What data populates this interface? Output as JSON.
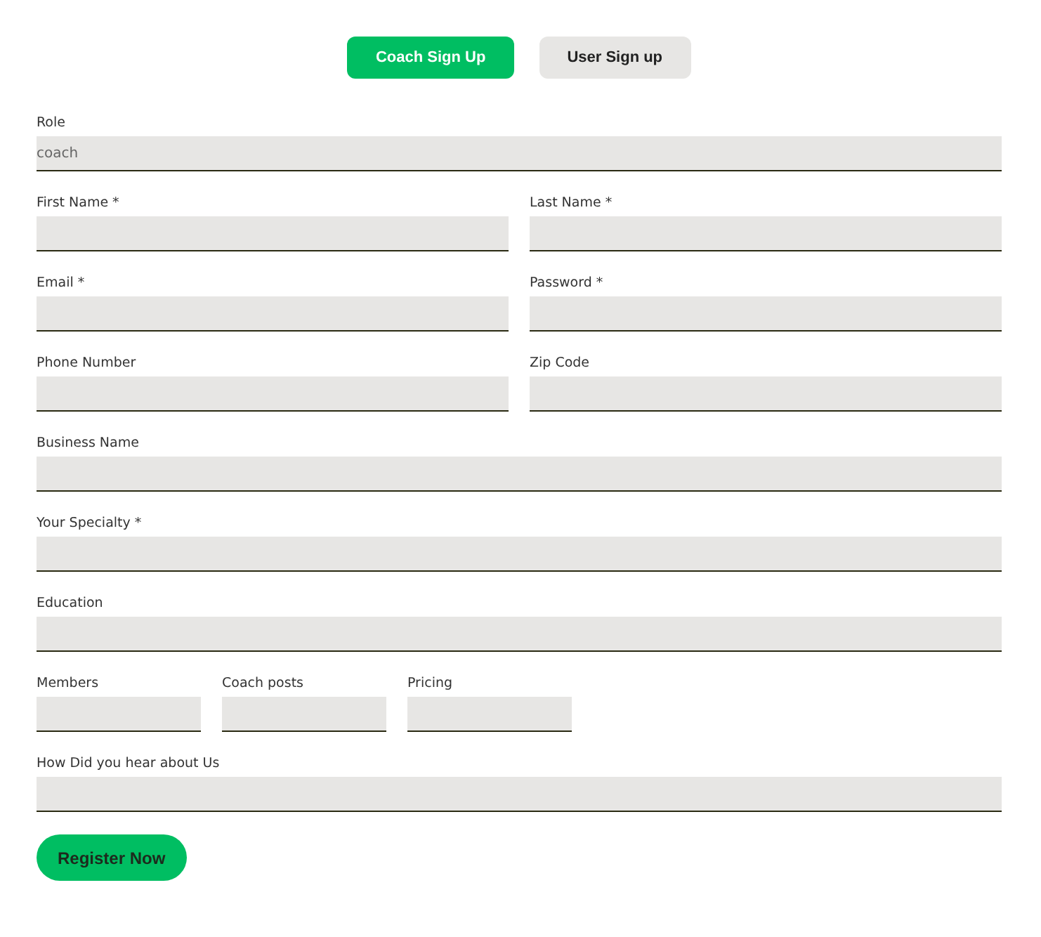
{
  "tabs": [
    {
      "label": "Coach Sign Up",
      "selected": true
    },
    {
      "label": "User Sign up",
      "selected": false
    }
  ],
  "rows": [
    {
      "kind": "full",
      "fields": [
        {
          "label": "Role",
          "value": "coach"
        }
      ]
    },
    {
      "kind": "half",
      "fields": [
        {
          "label": "First Name *"
        },
        {
          "label": "Last Name *"
        }
      ]
    },
    {
      "kind": "half",
      "fields": [
        {
          "label": "Email *"
        },
        {
          "label": "Password *"
        }
      ]
    },
    {
      "kind": "half",
      "fields": [
        {
          "label": "Phone Number"
        },
        {
          "label": "Zip Code"
        }
      ]
    },
    {
      "kind": "full",
      "fields": [
        {
          "label": "Business Name"
        }
      ]
    },
    {
      "kind": "full",
      "fields": [
        {
          "label": "Your Specialty *"
        }
      ]
    },
    {
      "kind": "full",
      "fields": [
        {
          "label": "Education"
        }
      ]
    },
    {
      "kind": "small",
      "fields": [
        {
          "label": "Members"
        },
        {
          "label": "Coach posts"
        },
        {
          "label": "Pricing"
        }
      ]
    },
    {
      "kind": "full",
      "fields": [
        {
          "label": "How Did you hear about Us"
        }
      ]
    }
  ],
  "submit": "Register Now"
}
